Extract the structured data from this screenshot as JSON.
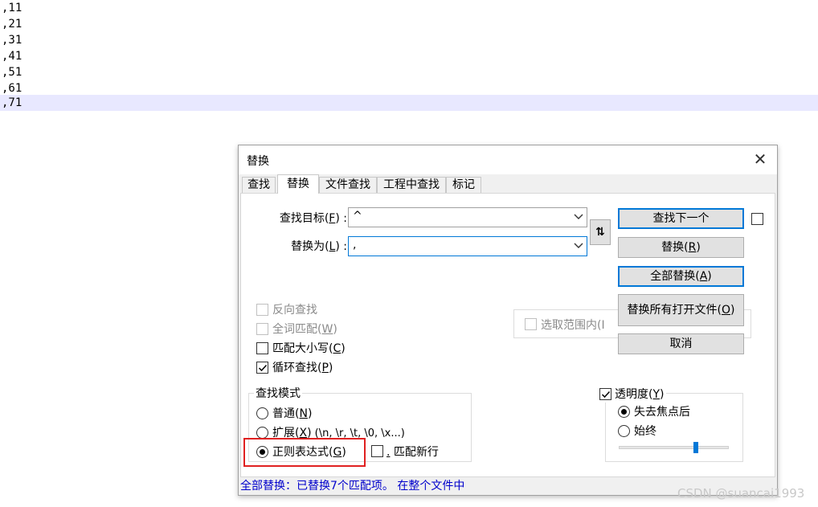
{
  "editor": {
    "lines": [
      ",11",
      ",21",
      ",31",
      ",41",
      ",51",
      ",61",
      ",71"
    ]
  },
  "dialog": {
    "title": "替换",
    "close_glyph": "✕",
    "tabs": [
      "查找",
      "替换",
      "文件查找",
      "工程中查找",
      "标记"
    ],
    "active_tab": "替换",
    "find_label": "查找目标",
    "find_hotkey": "F",
    "find_value": "^",
    "replace_label": "替换为",
    "replace_hotkey": "L",
    "replace_value": ",",
    "swap_glyph": "⇅",
    "buttons": {
      "find_next": "查找下一个",
      "replace": "替换",
      "replace_hotkey": "R",
      "replace_all": "全部替换",
      "replace_all_hotkey": "A",
      "replace_all_open": "替换所有打开文件",
      "replace_all_open_hotkey": "O",
      "cancel": "取消"
    },
    "in_selection": "选取范围内(I",
    "options": {
      "backward": "反向查找",
      "whole_word": "全词匹配",
      "whole_word_hotkey": "W",
      "match_case": "匹配大小写",
      "match_case_hotkey": "C",
      "wrap": "循环查找",
      "wrap_hotkey": "P"
    },
    "search_mode": {
      "title": "查找模式",
      "normal": "普通",
      "normal_hotkey": "N",
      "extended": "扩展",
      "extended_hotkey": "X",
      "extended_hint": " (\\n, \\r, \\t, \\0, \\x...)",
      "regex": "正则表达式",
      "regex_hotkey": "G",
      "dot_newline": "匹配新行",
      "dot_newline_hotkey": ".",
      "selected": "regex"
    },
    "transparency": {
      "label": "透明度",
      "hotkey": "Y",
      "on_lose_focus": "失去焦点后",
      "always": "始终",
      "level_fraction": 0.7
    },
    "status": "全部替换：已替换7个匹配项。 在整个文件中"
  },
  "watermark": "CSDN @suancai1993",
  "colors": {
    "current_line": "#e8e8ff",
    "accent": "#0078d7",
    "status_text": "#0000cc",
    "highlight_box": "#e02020"
  }
}
